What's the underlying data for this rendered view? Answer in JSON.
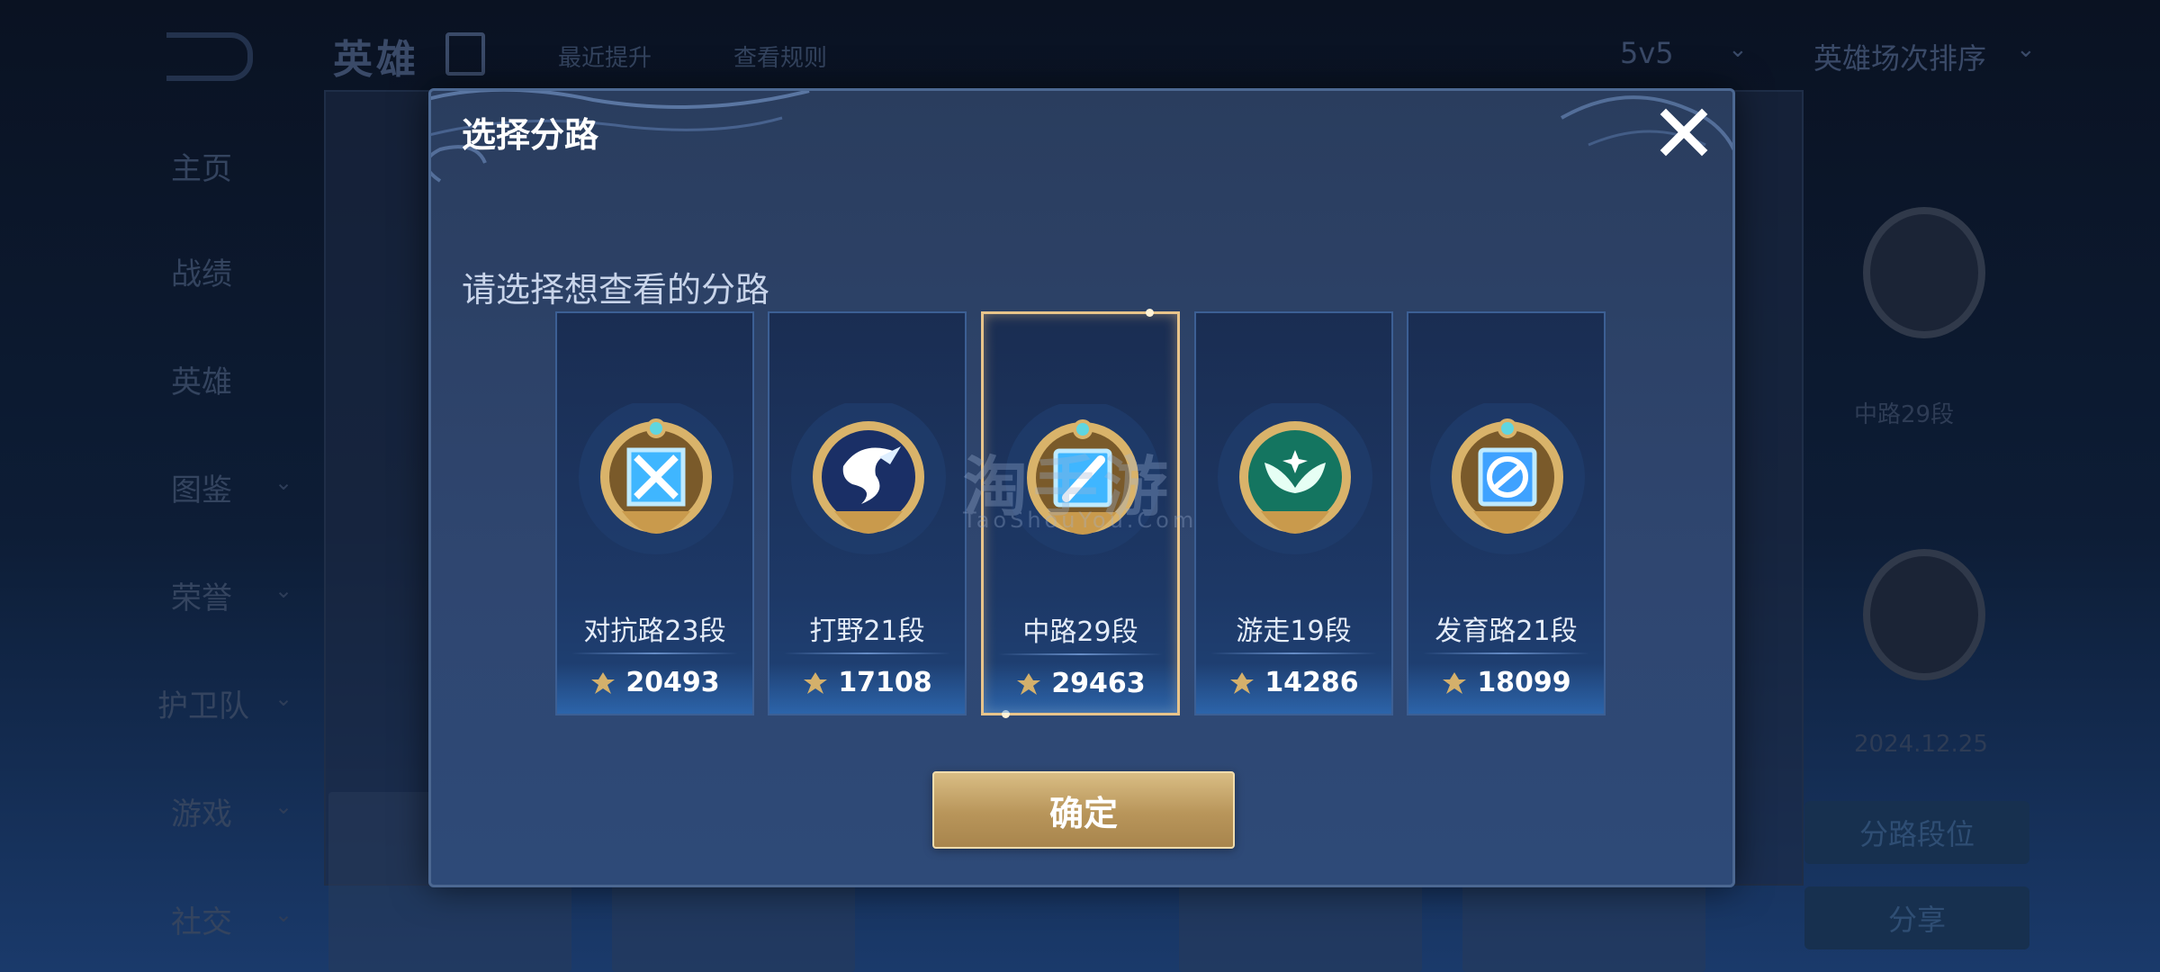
{
  "background": {
    "title": "英雄",
    "top_link_1": "最近提升",
    "top_link_2": "查看规则",
    "mode": "5v5",
    "sort": "英雄场次排序",
    "nav": [
      "主页",
      "战绩",
      "英雄",
      "图鉴",
      "荣誉",
      "护卫队",
      "游戏",
      "社交"
    ],
    "right_rank_label": "中路29段",
    "right_date": "2024.12.25",
    "right_btn_1": "分路段位",
    "right_btn_2": "分享"
  },
  "dialog": {
    "title": "选择分路",
    "prompt": "请选择想查看的分路",
    "confirm_label": "确定"
  },
  "lanes": [
    {
      "label": "对抗路23段",
      "score": "20493",
      "emblem": "sword-emblem-icon",
      "selected": false
    },
    {
      "label": "打野21段",
      "score": "17108",
      "emblem": "dragon-emblem-icon",
      "selected": false
    },
    {
      "label": "中路29段",
      "score": "29463",
      "emblem": "staff-emblem-icon",
      "selected": true
    },
    {
      "label": "游走19段",
      "score": "14286",
      "emblem": "wings-emblem-icon",
      "selected": false
    },
    {
      "label": "发育路21段",
      "score": "18099",
      "emblem": "bow-emblem-icon",
      "selected": false
    }
  ],
  "watermark": {
    "big": "淘手游",
    "small": "TaoShouYou.Com"
  },
  "colors": {
    "accent_gold": "#e8c48a",
    "dialog_bg": "#2f4670",
    "card_bg": "#1d3866",
    "confirm_gold": "#c7a76b"
  }
}
